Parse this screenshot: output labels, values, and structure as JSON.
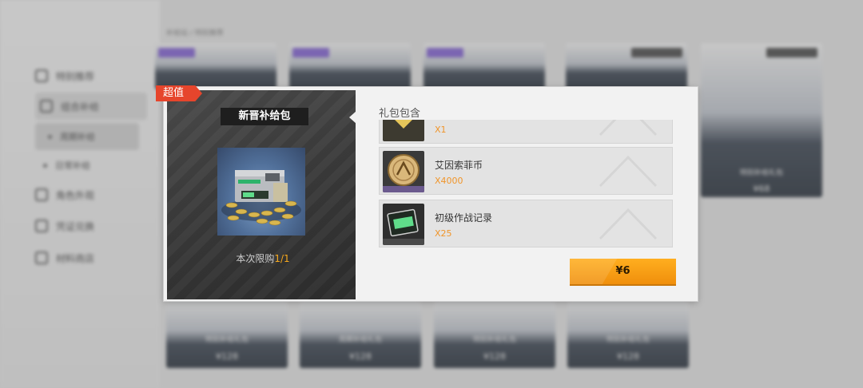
{
  "background": {
    "breadcrumb": "补给站 / 特别推荐",
    "nav": [
      {
        "label": "特别推荐",
        "icon": "star-icon"
      },
      {
        "label": "组合补给",
        "icon": "box-icon"
      },
      {
        "label": "周期补给",
        "icon": "dot-icon"
      },
      {
        "label": "日常补给",
        "icon": "dot-icon"
      },
      {
        "label": "角色外观",
        "icon": "shirt-icon"
      },
      {
        "label": "凭证兑换",
        "icon": "ticket-icon"
      },
      {
        "label": "材料商店",
        "icon": "cart-icon"
      }
    ],
    "top_cards": [
      "",
      "",
      "",
      "",
      "特别补给礼包"
    ],
    "top_card_prices": [
      "",
      "",
      "",
      "",
      "¥68"
    ],
    "bottom_cards": [
      "特别补给礼包",
      "周期补给礼包",
      "特别补给礼包",
      "特别补给礼包"
    ],
    "bottom_card_prices": [
      "¥128",
      "¥128",
      "¥128",
      "¥128"
    ]
  },
  "dialog": {
    "badge": "超值",
    "pack_title": "新晋补给包",
    "limit_prefix": "本次限购",
    "limit_count": "1/1",
    "contents_title": "礼包包含",
    "items": [
      {
        "name": "",
        "qty": "X1",
        "icon": "gem-ticket-icon"
      },
      {
        "name": "艾因索菲币",
        "qty": "X4000",
        "icon": "coin-icon"
      },
      {
        "name": "初级作战记录",
        "qty": "X25",
        "icon": "exp-card-icon"
      }
    ],
    "price": "¥6"
  },
  "colors": {
    "badge": "#e6452c",
    "quantity": "#f0952a",
    "limit_count": "#f7a91e",
    "buy_button": "#f59a12"
  }
}
